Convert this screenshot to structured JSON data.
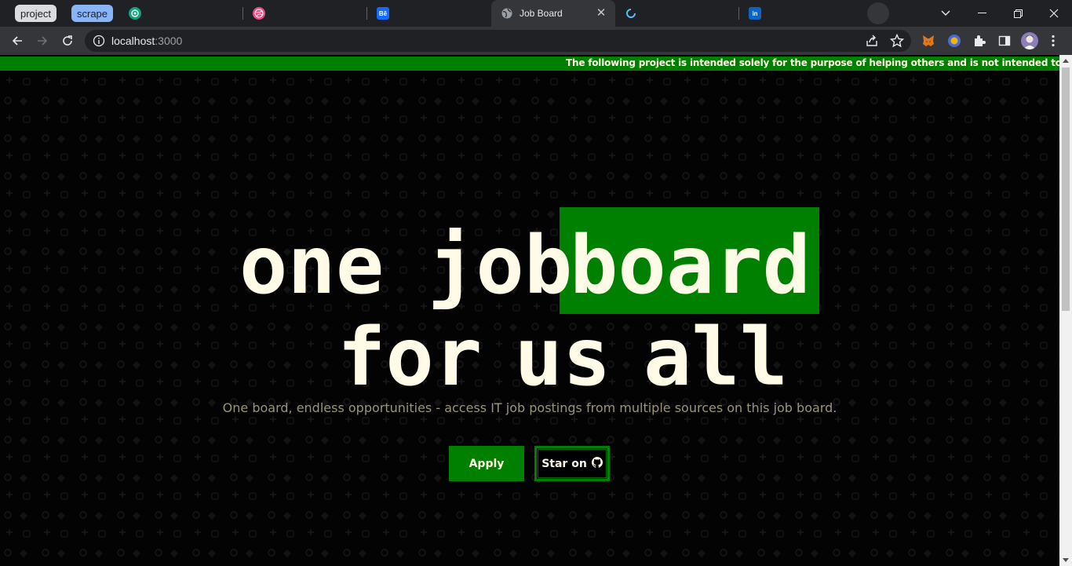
{
  "browser": {
    "tab_groups": [
      "project",
      "scrape"
    ],
    "tabs": [
      {
        "title": "",
        "icon": "openai-icon"
      },
      {
        "title": "",
        "icon": "dribbble-icon"
      },
      {
        "title": "",
        "icon": "behance-icon",
        "glyph": "Bē"
      },
      {
        "title": "Job Board",
        "icon": "globe-icon",
        "active": true
      },
      {
        "title": "",
        "icon": "loading-icon"
      },
      {
        "title": "",
        "icon": "linkedin-icon",
        "glyph": "in"
      }
    ],
    "url_host": "localhost",
    "url_port": ":3000"
  },
  "banner": {
    "text": "The following project is intended solely for the purpose of helping others and is not intended to generate any profit or"
  },
  "hero": {
    "line1_words": [
      "one",
      "job"
    ],
    "highlight_word": "board",
    "line2": "for us all",
    "subtitle": "One board, endless opportunities - access IT job postings from multiple sources on this job board."
  },
  "buttons": {
    "apply_label": "Apply",
    "star_label": "Star on"
  },
  "colors": {
    "accent": "#008000",
    "cream": "#fffbe6",
    "background": "#030303"
  }
}
